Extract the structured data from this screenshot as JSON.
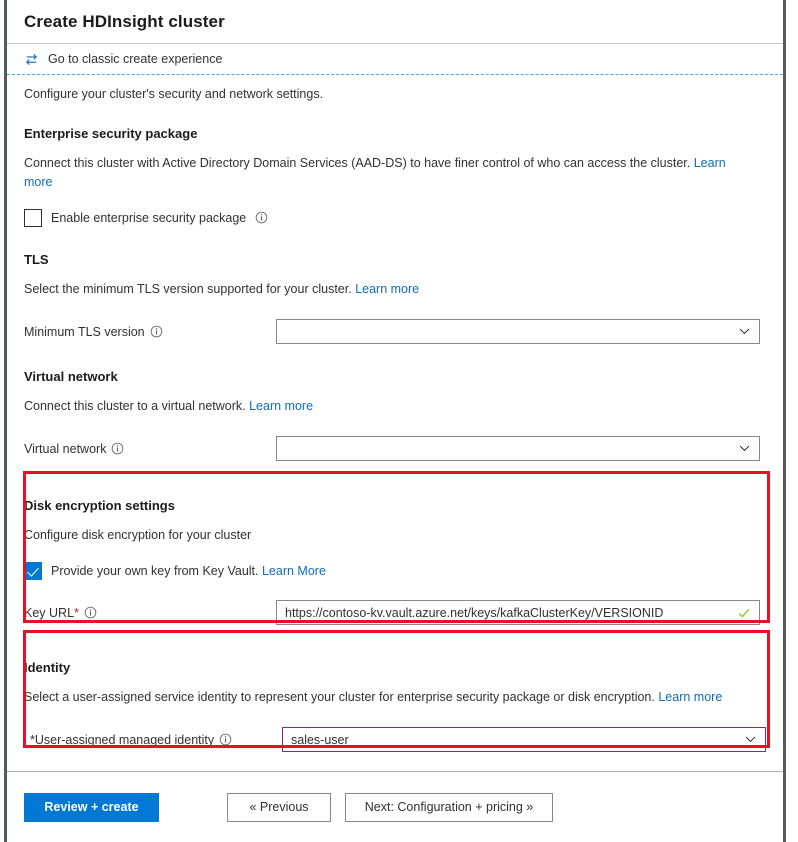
{
  "blade": {
    "title": "Create HDInsight cluster"
  },
  "command_bar": {
    "classic_link": "Go to classic create experience",
    "swap_icon": "swap-arrows-icon"
  },
  "intro": "Configure your cluster's security and network settings.",
  "sections": {
    "enterprise_security": {
      "heading": "Enterprise security package",
      "description": "Connect this cluster with Active Directory Domain Services (AAD-DS) to have finer control of who can access the cluster.",
      "learn_more": "Learn more",
      "checkbox_label": "Enable enterprise security package",
      "checkbox_checked": false,
      "info_icon": "info-icon"
    },
    "tls": {
      "heading": "TLS",
      "description": "Select the minimum TLS version supported for your cluster.",
      "learn_more": "Learn more",
      "field_label": "Minimum TLS version",
      "field_value": "",
      "info_icon": "info-icon",
      "chevron_icon": "chevron-down-icon"
    },
    "virtual_network": {
      "heading": "Virtual network",
      "description": "Connect this cluster to a virtual network.",
      "learn_more": "Learn more",
      "field_label": "Virtual network",
      "field_value": "",
      "info_icon": "info-icon",
      "chevron_icon": "chevron-down-icon"
    },
    "disk_encryption": {
      "heading": "Disk encryption settings",
      "description": "Configure disk encryption for your cluster",
      "checkbox_label": "Provide your own key from Key Vault.",
      "checkbox_checked": true,
      "learn_more": "Learn More",
      "key_url_label": "Key URL",
      "required_marker": "*",
      "key_url_value": "https://contoso-kv.vault.azure.net/keys/kafkaClusterKey/VERSIONID",
      "valid_icon": "check-valid-icon",
      "info_icon": "info-icon",
      "highlight_color": "#e81123"
    },
    "identity": {
      "heading": "Identity",
      "description": "Select a user-assigned service identity to represent your cluster for enterprise security package or disk encryption.",
      "learn_more": "Learn more",
      "field_label": "*User-assigned managed identity",
      "field_value": "sales-user",
      "info_icon": "info-icon",
      "chevron_icon": "chevron-down-icon",
      "field_border_color": "#86288b",
      "highlight_color": "#e81123"
    }
  },
  "footer": {
    "review_create": "Review + create",
    "previous": "« Previous",
    "next": "Next: Configuration + pricing »"
  },
  "colors": {
    "accent": "#0078d4",
    "link": "#0f6cbd",
    "annotation_red": "#e81123",
    "dashed_rule": "#38b3e0",
    "required_star": "#a4262c",
    "valid_green": "#7fba00"
  }
}
